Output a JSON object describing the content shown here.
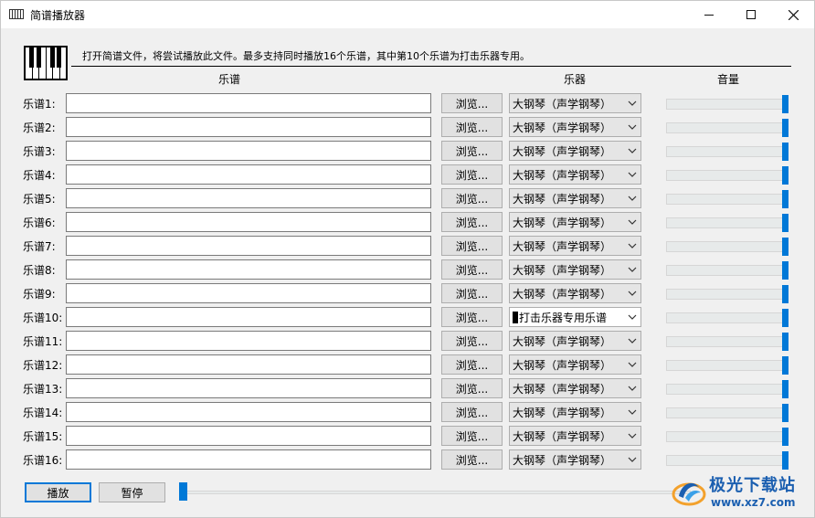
{
  "window": {
    "title": "简谱播放器",
    "controls": [
      "minimize",
      "maximize",
      "close"
    ]
  },
  "header": {
    "description": "打开简谱文件，将尝试播放此文件。最多支持同时播放16个乐谱，其中第10个乐谱为打击乐器专用。",
    "icon": "piano-keys-icon"
  },
  "columns": {
    "score": "乐谱",
    "instrument": "乐器",
    "volume": "音量"
  },
  "tracks": [
    {
      "label": "乐谱1:",
      "file": "",
      "browse": "浏览...",
      "instrument": "大钢琴（声学钢琴）",
      "volume_percent": 100,
      "enabled": true
    },
    {
      "label": "乐谱2:",
      "file": "",
      "browse": "浏览...",
      "instrument": "大钢琴（声学钢琴）",
      "volume_percent": 100,
      "enabled": true
    },
    {
      "label": "乐谱3:",
      "file": "",
      "browse": "浏览...",
      "instrument": "大钢琴（声学钢琴）",
      "volume_percent": 100,
      "enabled": true
    },
    {
      "label": "乐谱4:",
      "file": "",
      "browse": "浏览...",
      "instrument": "大钢琴（声学钢琴）",
      "volume_percent": 100,
      "enabled": true
    },
    {
      "label": "乐谱5:",
      "file": "",
      "browse": "浏览...",
      "instrument": "大钢琴（声学钢琴）",
      "volume_percent": 100,
      "enabled": true
    },
    {
      "label": "乐谱6:",
      "file": "",
      "browse": "浏览...",
      "instrument": "大钢琴（声学钢琴）",
      "volume_percent": 100,
      "enabled": true
    },
    {
      "label": "乐谱7:",
      "file": "",
      "browse": "浏览...",
      "instrument": "大钢琴（声学钢琴）",
      "volume_percent": 100,
      "enabled": true
    },
    {
      "label": "乐谱8:",
      "file": "",
      "browse": "浏览...",
      "instrument": "大钢琴（声学钢琴）",
      "volume_percent": 100,
      "enabled": true
    },
    {
      "label": "乐谱9:",
      "file": "",
      "browse": "浏览...",
      "instrument": "大钢琴（声学钢琴）",
      "volume_percent": 100,
      "enabled": true
    },
    {
      "label": "乐谱10:",
      "file": "",
      "browse": "浏览...",
      "instrument": "打击乐器专用乐谱",
      "volume_percent": 100,
      "enabled": false
    },
    {
      "label": "乐谱11:",
      "file": "",
      "browse": "浏览...",
      "instrument": "大钢琴（声学钢琴）",
      "volume_percent": 100,
      "enabled": true
    },
    {
      "label": "乐谱12:",
      "file": "",
      "browse": "浏览...",
      "instrument": "大钢琴（声学钢琴）",
      "volume_percent": 100,
      "enabled": true
    },
    {
      "label": "乐谱13:",
      "file": "",
      "browse": "浏览...",
      "instrument": "大钢琴（声学钢琴）",
      "volume_percent": 100,
      "enabled": true
    },
    {
      "label": "乐谱14:",
      "file": "",
      "browse": "浏览...",
      "instrument": "大钢琴（声学钢琴）",
      "volume_percent": 100,
      "enabled": true
    },
    {
      "label": "乐谱15:",
      "file": "",
      "browse": "浏览...",
      "instrument": "大钢琴（声学钢琴）",
      "volume_percent": 100,
      "enabled": true
    },
    {
      "label": "乐谱16:",
      "file": "",
      "browse": "浏览...",
      "instrument": "大钢琴（声学钢琴）",
      "volume_percent": 100,
      "enabled": true
    }
  ],
  "controls": {
    "play": "播放",
    "pause": "暂停",
    "progress_percent": 0
  },
  "watermark": {
    "title": "极光下载站",
    "url": "www.xz7.com"
  },
  "colors": {
    "accent": "#0078d7",
    "window_bg": "#f0f0f0",
    "watermark": "#1b5fb0"
  }
}
